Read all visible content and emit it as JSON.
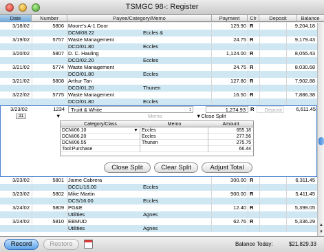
{
  "window": {
    "title": "TSMGC 98-: Register"
  },
  "columns": {
    "date": "Date",
    "number": "Number",
    "payee": "Payee/Category/Memo",
    "payment": "Payment",
    "clr": "Clr",
    "deposit": "Deposit",
    "balance": "Balance"
  },
  "transactions_before": [
    {
      "date": "3/18/02",
      "number": "5806",
      "payee": "Moore's A-1 Door",
      "category": "DCM/08.22",
      "memo": "Eccles &",
      "payment": "129.90",
      "clr": "R",
      "balance": "9,204.18"
    },
    {
      "date": "3/19/02",
      "number": "5757",
      "payee": "Waste Management",
      "category": "DCO/01.80",
      "memo": "Eccles",
      "payment": "24.75",
      "clr": "R",
      "balance": "9,179.43"
    },
    {
      "date": "3/20/02",
      "number": "5807",
      "payee": "D. C. Hauling",
      "category": "DCO/02.20",
      "memo": "Eccles",
      "payment": "1,124.00",
      "clr": "R",
      "balance": "8,055.43"
    },
    {
      "date": "3/21/02",
      "number": "5774",
      "payee": "Waste Management",
      "category": "DCO/01.80",
      "memo": "Eccles",
      "payment": "24.75",
      "clr": "R",
      "balance": "8,030.68"
    },
    {
      "date": "3/21/02",
      "number": "5808",
      "payee": "Arthur Tan",
      "category": "DCO/01.20",
      "memo": "Thunen",
      "payment": "127.80",
      "clr": "R",
      "balance": "7,902.88"
    },
    {
      "date": "3/22/02",
      "number": "5775",
      "payee": "Waste Management",
      "category": "DCO/01.80",
      "memo": "Eccles",
      "payment": "16.50",
      "clr": "R",
      "balance": "7,886.38"
    }
  ],
  "active": {
    "date": "3/23/02",
    "number": "1234",
    "payee": "Truitt & White",
    "payment": "1,274.93",
    "clr": "R",
    "deposit_placeholder": "Deposit",
    "balance": "6,611.45",
    "memo_placeholder": "Memo",
    "close_split_link": "Close Split"
  },
  "split": {
    "headers": {
      "category": "Category/Class",
      "memo": "Memo",
      "amount": "Amount"
    },
    "rows": [
      {
        "category": "DCM/06.10",
        "memo": "Eccles",
        "amount": "655.18"
      },
      {
        "category": "DCM/06.20",
        "memo": "Eccles",
        "amount": "277.56"
      },
      {
        "category": "DCM/06.55",
        "memo": "Thunen",
        "amount": "275.75"
      },
      {
        "category": "Tool:Purchase",
        "memo": "",
        "amount": "66.44"
      }
    ],
    "buttons": {
      "close": "Close Split",
      "clear": "Clear Split",
      "adjust": "Adjust Total"
    }
  },
  "transactions_after": [
    {
      "date": "3/23/02",
      "number": "5801",
      "payee": "Jaime Cabrera",
      "category": "DCCL/16.00",
      "memo": "Eccles",
      "payment": "300.00",
      "clr": "R",
      "balance": "6,311.45"
    },
    {
      "date": "3/23/02",
      "number": "5802",
      "payee": "Mike Martin",
      "category": "DCS/16.00",
      "memo": "Eccles",
      "payment": "900.00",
      "clr": "R",
      "balance": "5,411.45"
    },
    {
      "date": "3/24/02",
      "number": "5809",
      "payee": "PG&E",
      "category": "Utilities",
      "memo": "Agnes",
      "payment": "12.40",
      "clr": "R",
      "balance": "5,399.05"
    },
    {
      "date": "3/24/02",
      "number": "5810",
      "payee": "EBMUD",
      "category": "Utilities",
      "memo": "Agnes",
      "payment": "62.76",
      "clr": "R",
      "balance": "5,336.29"
    }
  ],
  "footer": {
    "record_label": "Record",
    "restore_label": "Restore",
    "balance_label": "Balance Today:",
    "balance_value": "$21,829.33"
  },
  "icons": [
    "close-icon",
    "minimize-icon",
    "zoom-icon",
    "calendar-icon",
    "dropdown-arrow-icon",
    "scroll-up-icon",
    "scroll-down-icon"
  ],
  "colors": {
    "row_stripe": "#cfe7f2",
    "accent": "#4a7fd0"
  }
}
